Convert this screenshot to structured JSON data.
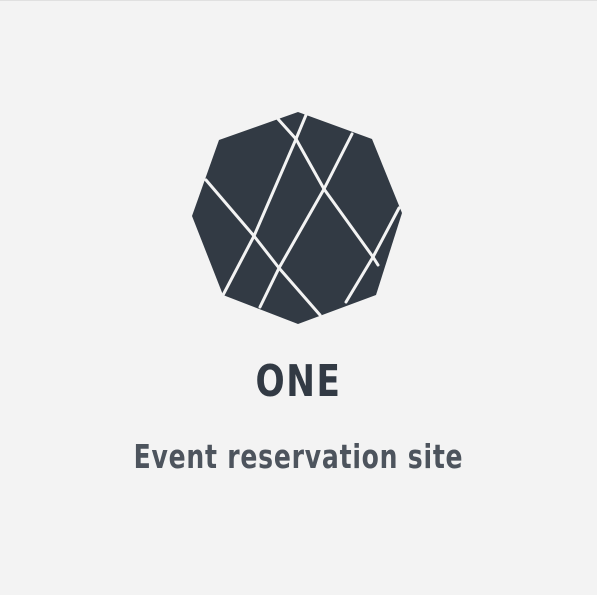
{
  "logo": {
    "icon": "faceted-octagon-gem-icon",
    "fill_color": "#323a44",
    "line_color": "#f3f3f3"
  },
  "brand": {
    "name": "ONE",
    "color": "#323a44"
  },
  "tagline": {
    "text": "Event reservation site",
    "color": "#4d545d"
  },
  "background_color": "#f3f3f3"
}
